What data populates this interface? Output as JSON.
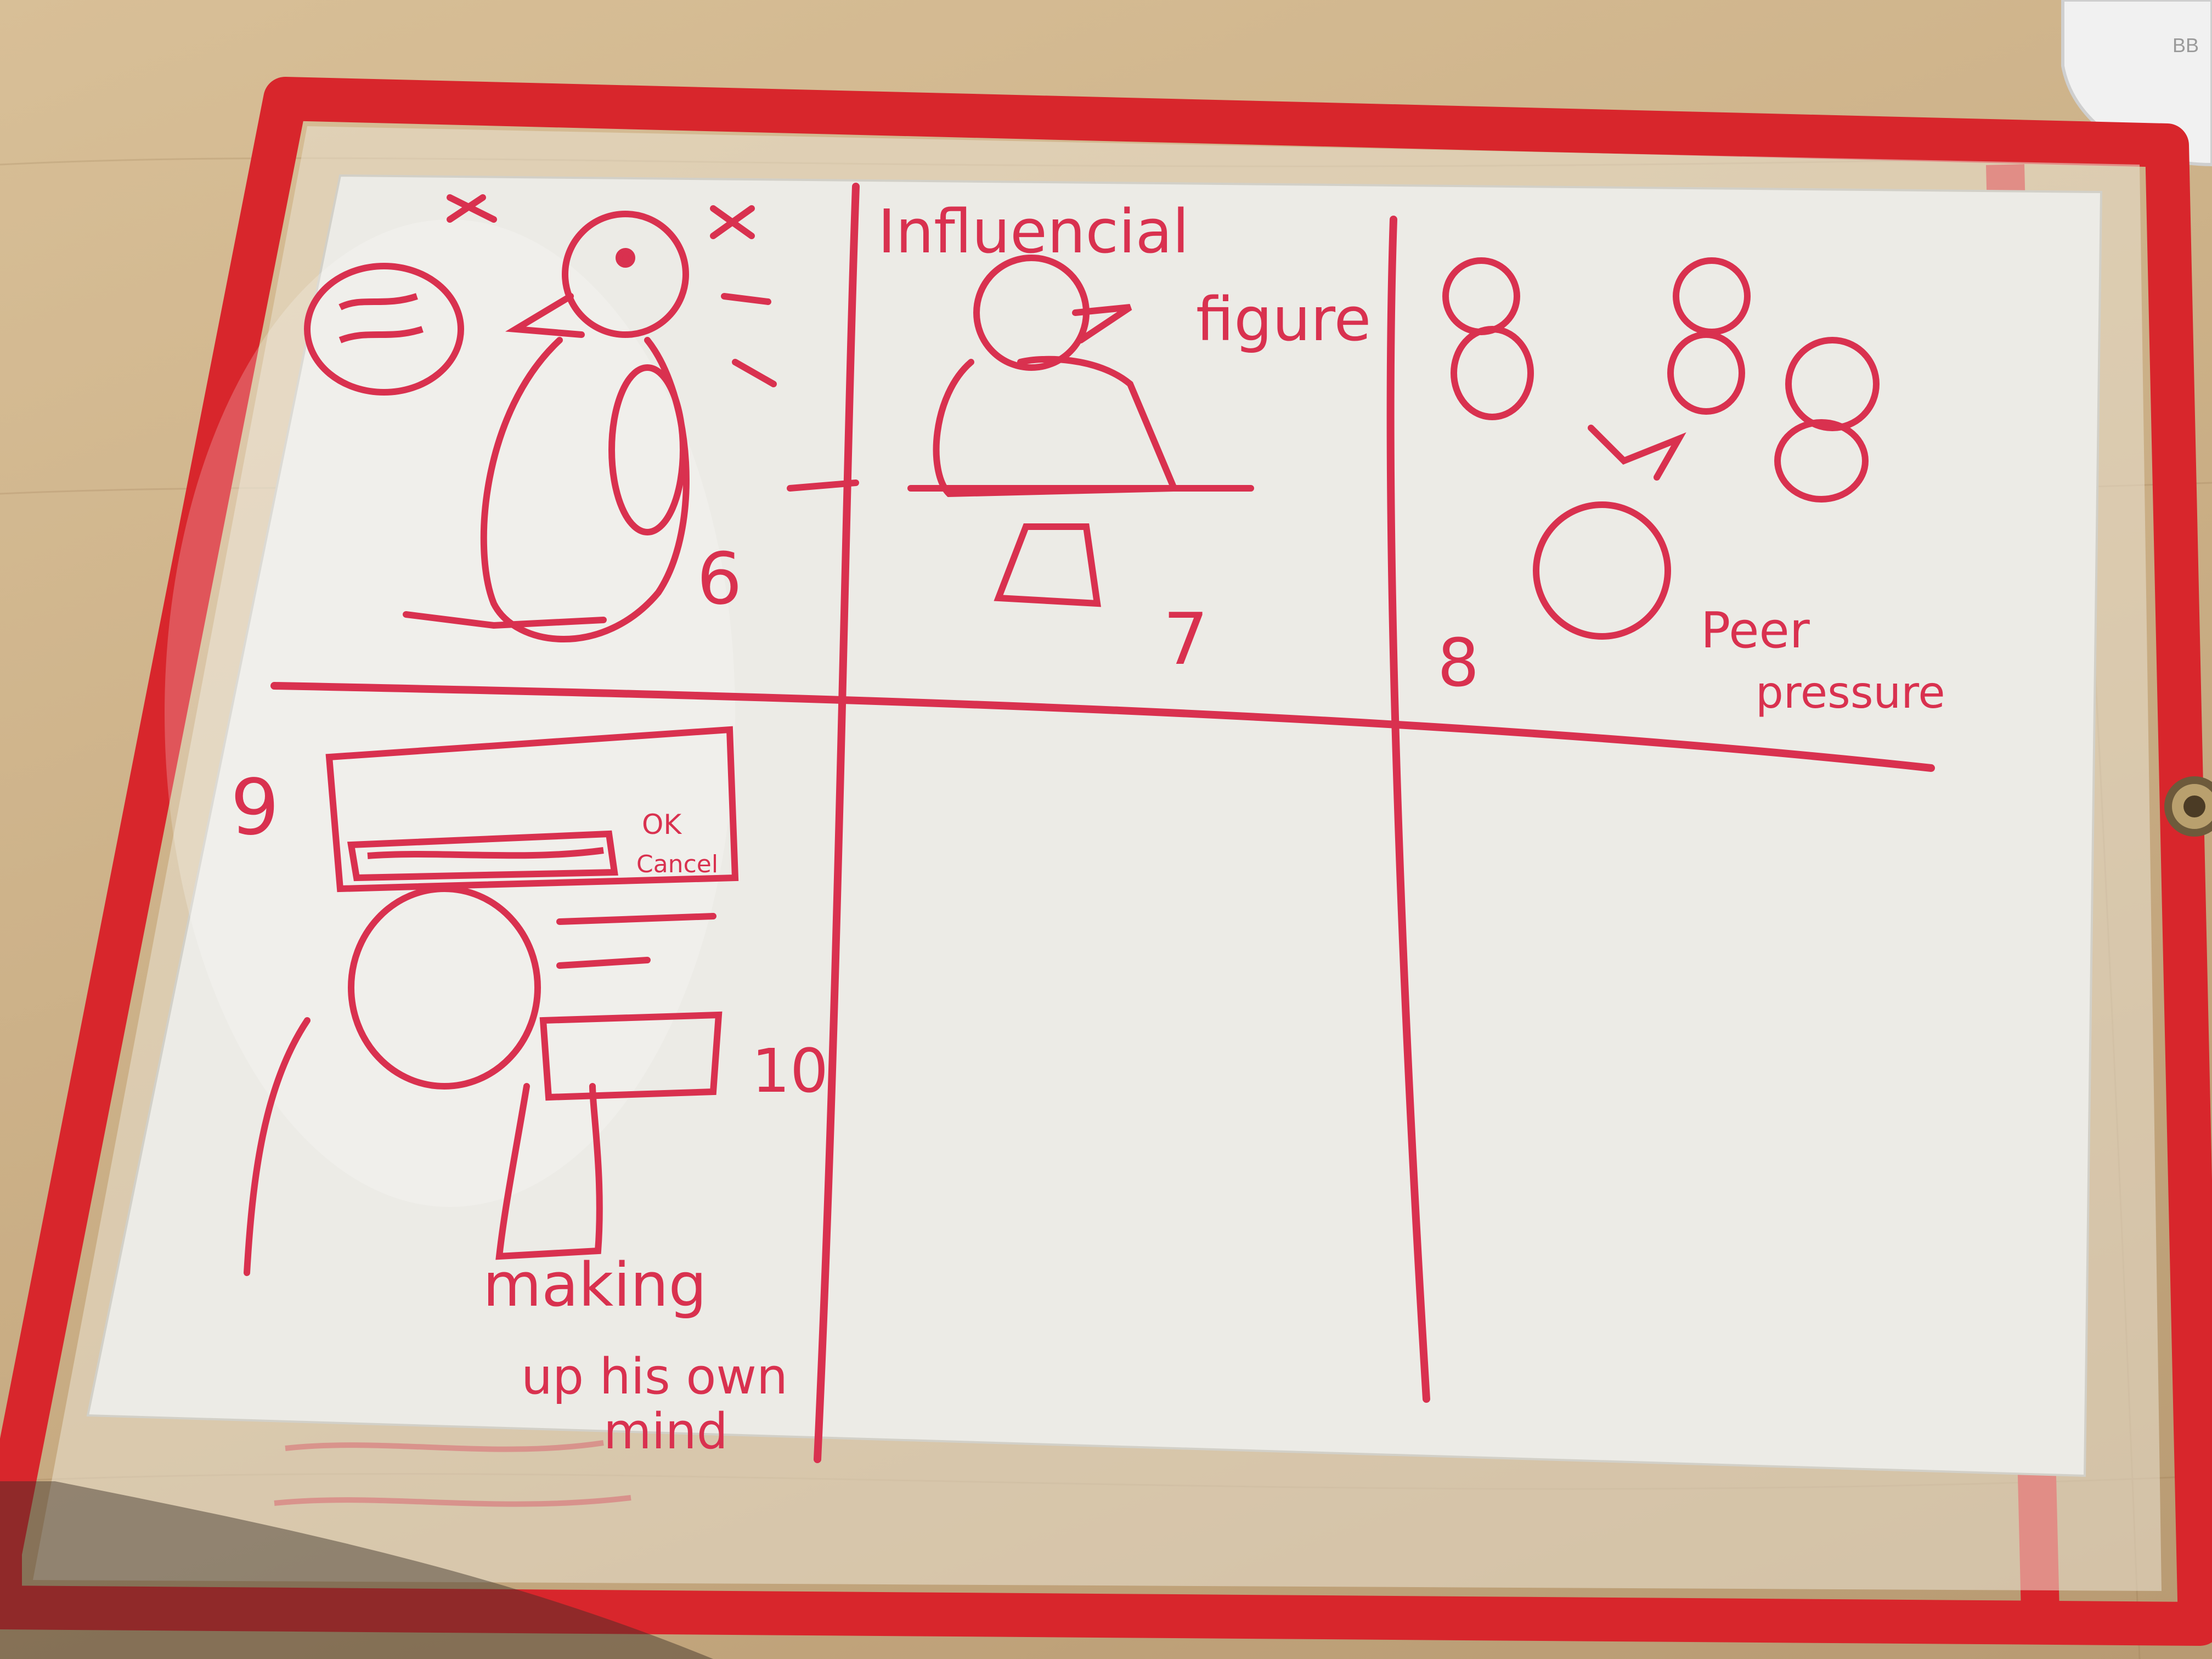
{
  "scene": {
    "description_free": true,
    "colors": {
      "desk": "#c9ad84",
      "sleeve_border": "#d8262c",
      "paper": "#ecebe6",
      "marker": "#d9314f",
      "device": "#f2f2f2"
    }
  },
  "storyboard": {
    "panel_6": {
      "number": "6"
    },
    "panel_7": {
      "number": "7",
      "caption_line1": "Influencial",
      "caption_line2": "figure"
    },
    "panel_8": {
      "number": "8",
      "caption_line1": "Peer",
      "caption_line2": "pressure"
    },
    "panel_9": {
      "number": "9",
      "dialog_ok": "OK",
      "dialog_cancel": "Cancel"
    },
    "panel_10": {
      "number": "10",
      "caption_line1": "making",
      "caption_line2": "up his own",
      "caption_line3": "mind"
    }
  },
  "device": {
    "label": "BB"
  }
}
